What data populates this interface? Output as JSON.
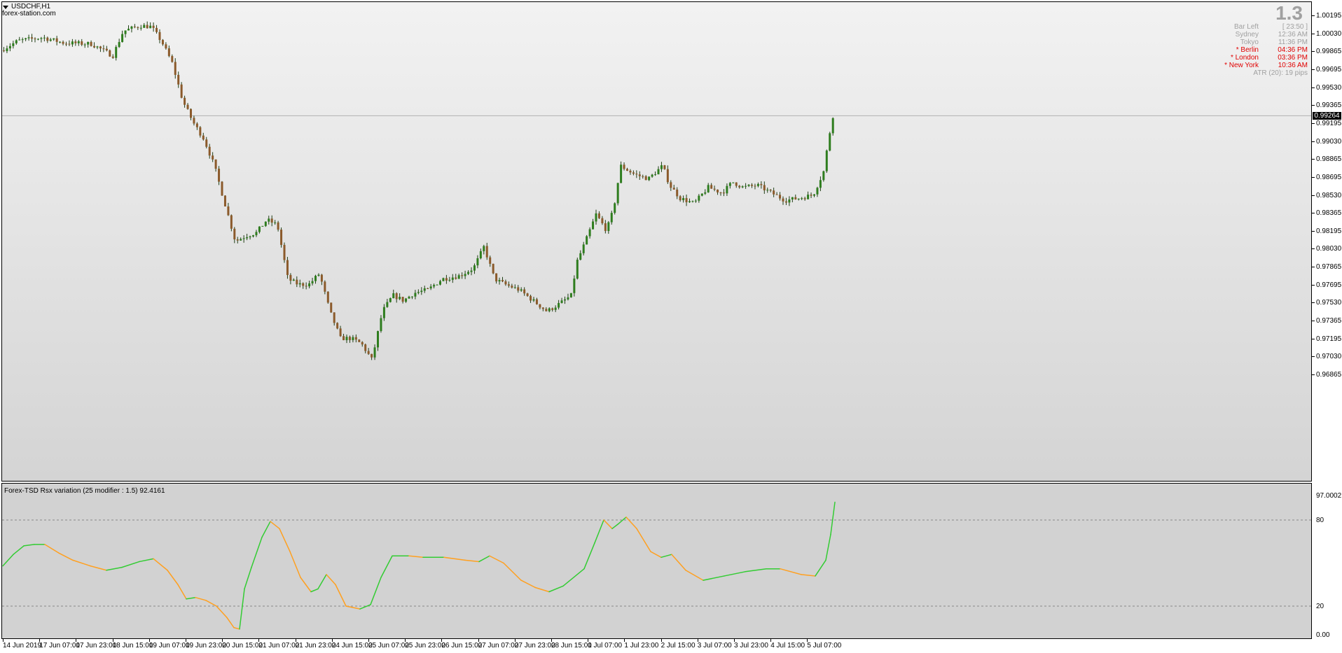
{
  "chart_header": {
    "symbol_title": "USDCHF,H1",
    "source": "forex-station.com"
  },
  "spread_panel": {
    "value": "1.3",
    "rows": [
      {
        "key": "Bar Left",
        "value": "[ 23:50 ]",
        "color": "#a0a0a0"
      },
      {
        "key": "Sydney",
        "value": "12:36 AM",
        "color": "#a0a0a0"
      },
      {
        "key": "Tokyo",
        "value": "11:36 PM",
        "color": "#a0a0a0"
      },
      {
        "key": "* Berlin",
        "value": "04:36 PM",
        "color": "#e00000"
      },
      {
        "key": "* London",
        "value": "03:36 PM",
        "color": "#e00000"
      },
      {
        "key": "* New York",
        "value": "10:36 AM",
        "color": "#e00000"
      }
    ],
    "atr": "ATR (20): 19 pips"
  },
  "indicator": {
    "title": "Forex-TSD Rsx variation (25 modifier : 1.5) 92.4161",
    "axis_labels": [
      "97.0002",
      "80",
      "20",
      "0.00"
    ],
    "levels": [
      80,
      20
    ],
    "rising_color": "#33cc33",
    "falling_color": "#ffa020"
  },
  "price_axis": {
    "labels": [
      "1.00195",
      "1.00030",
      "0.99865",
      "0.99695",
      "0.99530",
      "0.99365",
      "0.99195",
      "0.99030",
      "0.98865",
      "0.98695",
      "0.98530",
      "0.98365",
      "0.98195",
      "0.98030",
      "0.97865",
      "0.97695",
      "0.97530",
      "0.97365",
      "0.97195",
      "0.97030",
      "0.96865"
    ],
    "current_price": "0.99264"
  },
  "time_axis": {
    "labels": [
      "14 Jun 2019",
      "17 Jun 07:00",
      "17 Jun 23:00",
      "18 Jun 15:00",
      "19 Jun 07:00",
      "19 Jun 23:00",
      "20 Jun 15:00",
      "21 Jun 07:00",
      "21 Jun 23:00",
      "24 Jun 15:00",
      "25 Jun 07:00",
      "25 Jun 23:00",
      "26 Jun 15:00",
      "27 Jun 07:00",
      "27 Jun 23:00",
      "28 Jun 15:00",
      "1 Jul 07:00",
      "1 Jul 23:00",
      "2 Jul 15:00",
      "3 Jul 07:00",
      "3 Jul 23:00",
      "4 Jul 15:00",
      "5 Jul 07:00"
    ]
  },
  "colors": {
    "bull_candle": "#2e7d1e",
    "bear_candle": "#8b5a2b",
    "wick": "#1f3d14",
    "bid_line": "#b0b0b0"
  },
  "chart_data": [
    {
      "type": "candlestick",
      "symbol": "USDCHF",
      "timeframe": "H1",
      "ylim": [
        0.96865,
        1.00195
      ],
      "current_price": 0.99264,
      "close_path": [
        [
          0,
          0.9987
        ],
        [
          25,
          0.9996
        ],
        [
          60,
          0.9999
        ],
        [
          90,
          0.9994
        ],
        [
          130,
          0.9993
        ],
        [
          160,
          0.9982
        ],
        [
          175,
          1.0005
        ],
        [
          200,
          1.001
        ],
        [
          215,
          1.0009
        ],
        [
          230,
          0.9995
        ],
        [
          245,
          0.9975
        ],
        [
          260,
          0.994
        ],
        [
          275,
          0.992
        ],
        [
          290,
          0.9905
        ],
        [
          305,
          0.988
        ],
        [
          320,
          0.9845
        ],
        [
          335,
          0.981
        ],
        [
          350,
          0.9815
        ],
        [
          365,
          0.9818
        ],
        [
          380,
          0.983
        ],
        [
          395,
          0.9825
        ],
        [
          410,
          0.9775
        ],
        [
          425,
          0.977
        ],
        [
          440,
          0.977
        ],
        [
          455,
          0.978
        ],
        [
          470,
          0.9745
        ],
        [
          485,
          0.972
        ],
        [
          500,
          0.972
        ],
        [
          515,
          0.9715
        ],
        [
          530,
          0.97
        ],
        [
          545,
          0.9745
        ],
        [
          560,
          0.976
        ],
        [
          575,
          0.9755
        ],
        [
          590,
          0.9762
        ],
        [
          610,
          0.9765
        ],
        [
          630,
          0.9775
        ],
        [
          655,
          0.9778
        ],
        [
          675,
          0.9785
        ],
        [
          690,
          0.9805
        ],
        [
          705,
          0.9775
        ],
        [
          720,
          0.977
        ],
        [
          740,
          0.9765
        ],
        [
          760,
          0.9755
        ],
        [
          780,
          0.9745
        ],
        [
          800,
          0.9753
        ],
        [
          815,
          0.976
        ],
        [
          822,
          0.979
        ],
        [
          835,
          0.981
        ],
        [
          850,
          0.9835
        ],
        [
          865,
          0.982
        ],
        [
          875,
          0.984
        ],
        [
          885,
          0.988
        ],
        [
          905,
          0.9872
        ],
        [
          925,
          0.9868
        ],
        [
          945,
          0.988
        ],
        [
          955,
          0.9862
        ],
        [
          970,
          0.985
        ],
        [
          990,
          0.9845
        ],
        [
          1010,
          0.986
        ],
        [
          1030,
          0.9855
        ],
        [
          1045,
          0.9865
        ],
        [
          1060,
          0.986
        ],
        [
          1080,
          0.9862
        ],
        [
          1100,
          0.9855
        ],
        [
          1120,
          0.9848
        ],
        [
          1140,
          0.985
        ],
        [
          1160,
          0.9853
        ],
        [
          1175,
          0.9875
        ],
        [
          1182,
          0.9905
        ],
        [
          1188,
          0.99264
        ]
      ]
    },
    {
      "type": "line",
      "name": "Forex-TSD Rsx variation (25 modifier : 1.5)",
      "ylim": [
        0,
        100
      ],
      "levels": [
        20,
        80
      ],
      "last_value": 92.4161,
      "values": [
        [
          0,
          48
        ],
        [
          15,
          56
        ],
        [
          30,
          62
        ],
        [
          45,
          63
        ],
        [
          60,
          63
        ],
        [
          80,
          57
        ],
        [
          100,
          52
        ],
        [
          125,
          48
        ],
        [
          148,
          45
        ],
        [
          170,
          47
        ],
        [
          195,
          51
        ],
        [
          215,
          53
        ],
        [
          235,
          45
        ],
        [
          250,
          35
        ],
        [
          262,
          25
        ],
        [
          275,
          26
        ],
        [
          290,
          24
        ],
        [
          305,
          20
        ],
        [
          320,
          12
        ],
        [
          330,
          5
        ],
        [
          338,
          4
        ],
        [
          345,
          32
        ],
        [
          355,
          47
        ],
        [
          370,
          68
        ],
        [
          382,
          79
        ],
        [
          395,
          74
        ],
        [
          410,
          58
        ],
        [
          425,
          40
        ],
        [
          440,
          30
        ],
        [
          450,
          32
        ],
        [
          462,
          42
        ],
        [
          475,
          35
        ],
        [
          490,
          20
        ],
        [
          510,
          18
        ],
        [
          525,
          21
        ],
        [
          540,
          40
        ],
        [
          556,
          55
        ],
        [
          580,
          55
        ],
        [
          600,
          54
        ],
        [
          630,
          54
        ],
        [
          660,
          52
        ],
        [
          680,
          51
        ],
        [
          695,
          55
        ],
        [
          715,
          50
        ],
        [
          740,
          38
        ],
        [
          760,
          33
        ],
        [
          780,
          30
        ],
        [
          800,
          34
        ],
        [
          830,
          46
        ],
        [
          845,
          64
        ],
        [
          858,
          80
        ],
        [
          870,
          74
        ],
        [
          878,
          77
        ],
        [
          890,
          82
        ],
        [
          905,
          74
        ],
        [
          925,
          58
        ],
        [
          940,
          54
        ],
        [
          955,
          56
        ],
        [
          975,
          45
        ],
        [
          1000,
          38
        ],
        [
          1030,
          41
        ],
        [
          1060,
          44
        ],
        [
          1090,
          46
        ],
        [
          1110,
          46
        ],
        [
          1140,
          42
        ],
        [
          1160,
          41
        ],
        [
          1175,
          52
        ],
        [
          1182,
          70
        ],
        [
          1188,
          92.4161
        ]
      ]
    }
  ]
}
